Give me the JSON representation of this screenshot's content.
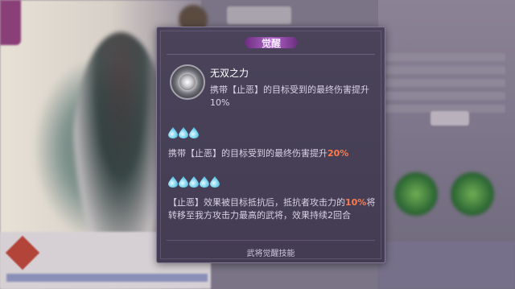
{
  "popup": {
    "title": "觉醒",
    "skill": {
      "icon": "skill-burst-icon",
      "name": "无双之力",
      "desc": "携带【止恶】的目标受到的最终伤害提升10%"
    },
    "tiers": [
      {
        "drops": 3,
        "text_before": "携带【止恶】的目标受到的最终伤害提升",
        "highlight": "20%",
        "text_after": ""
      },
      {
        "drops": 5,
        "text_before": "【止恶】效果被目标抵抗后，抵抗者攻击力的",
        "highlight": "10%",
        "text_after": "将转移至我方攻击力最高的武将，效果持续2回合"
      }
    ],
    "footer": "武将觉醒技能"
  },
  "colors": {
    "highlight": "#ff7a4a",
    "panel_bg": "#463f55",
    "title_badge": "#a25bbd",
    "drop": "#7ad3ee"
  }
}
